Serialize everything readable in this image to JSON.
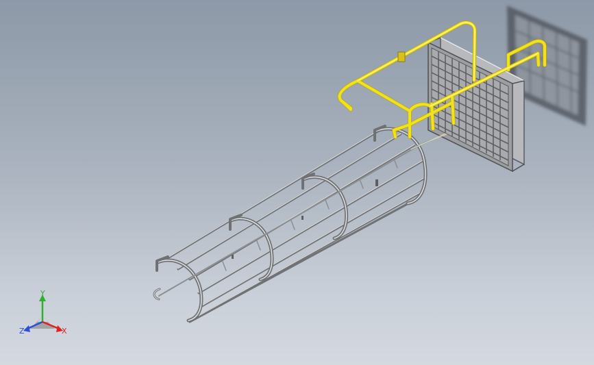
{
  "viewport": {
    "background_top": "#8d99a8",
    "background_bottom": "#d4d9e0"
  },
  "model": {
    "cage_color": "#7d7f82",
    "cage_highlight": "#d8d9db",
    "railing_color": "#f2e21c",
    "railing_shadow": "#b9a80f",
    "grate_color": "#6e7073",
    "grate_face": "#a8aaad"
  },
  "triad": {
    "labels": {
      "x": "X",
      "y": "Y",
      "z": "Z"
    },
    "colors": {
      "x": "#e0211f",
      "y": "#2fb02f",
      "z": "#2b4fd8"
    }
  }
}
